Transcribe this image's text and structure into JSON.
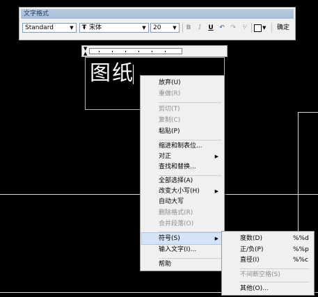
{
  "toolbar": {
    "title": "文字格式",
    "style_value": "Standard",
    "font_value": "宋体",
    "font_icon": "Ŧ",
    "size_value": "20",
    "bold_label": "B",
    "italic_label": "I",
    "underline_label": "U",
    "undo_icon": "↶",
    "redo_icon": "↷",
    "stack_icon": "⅟",
    "color_swatch": "#ffffff",
    "ok_label": "确定"
  },
  "editor": {
    "text": "图纸"
  },
  "context_menu": {
    "items": [
      {
        "label": "放弃(U)",
        "disabled": false
      },
      {
        "label": "重做(R)",
        "disabled": true
      },
      {
        "label": "剪切(T)",
        "disabled": true
      },
      {
        "label": "复制(C)",
        "disabled": true
      },
      {
        "label": "粘贴(P)",
        "disabled": false
      },
      {
        "label": "缩进和制表位...",
        "disabled": false
      },
      {
        "label": "对正",
        "disabled": false
      },
      {
        "label": "查找和替换...",
        "disabled": false
      },
      {
        "label": "全部选择(A)",
        "disabled": false
      },
      {
        "label": "改变大小写(H)",
        "disabled": false
      },
      {
        "label": "自动大写",
        "disabled": false
      },
      {
        "label": "删除格式(R)",
        "disabled": true
      },
      {
        "label": "合并段落(O)",
        "disabled": true
      },
      {
        "label": "符号(S)",
        "disabled": false
      },
      {
        "label": "输入文字(I)...",
        "disabled": false
      },
      {
        "label": "帮助",
        "disabled": false
      }
    ]
  },
  "symbol_submenu": {
    "items": [
      {
        "label": "度数(D)",
        "code": "%%d",
        "disabled": false
      },
      {
        "label": "正/负(P)",
        "code": "%%p",
        "disabled": false
      },
      {
        "label": "直径(I)",
        "code": "%%c",
        "disabled": false
      },
      {
        "label": "不间断空格(S)",
        "code": "",
        "disabled": true
      },
      {
        "label": "其他(O)...",
        "code": "",
        "disabled": false
      }
    ]
  },
  "colors": {
    "background": "#000000",
    "menu_bg": "#f0f0f0",
    "highlight": "#d4e4f6",
    "title_bar": "#a8bdd6"
  }
}
